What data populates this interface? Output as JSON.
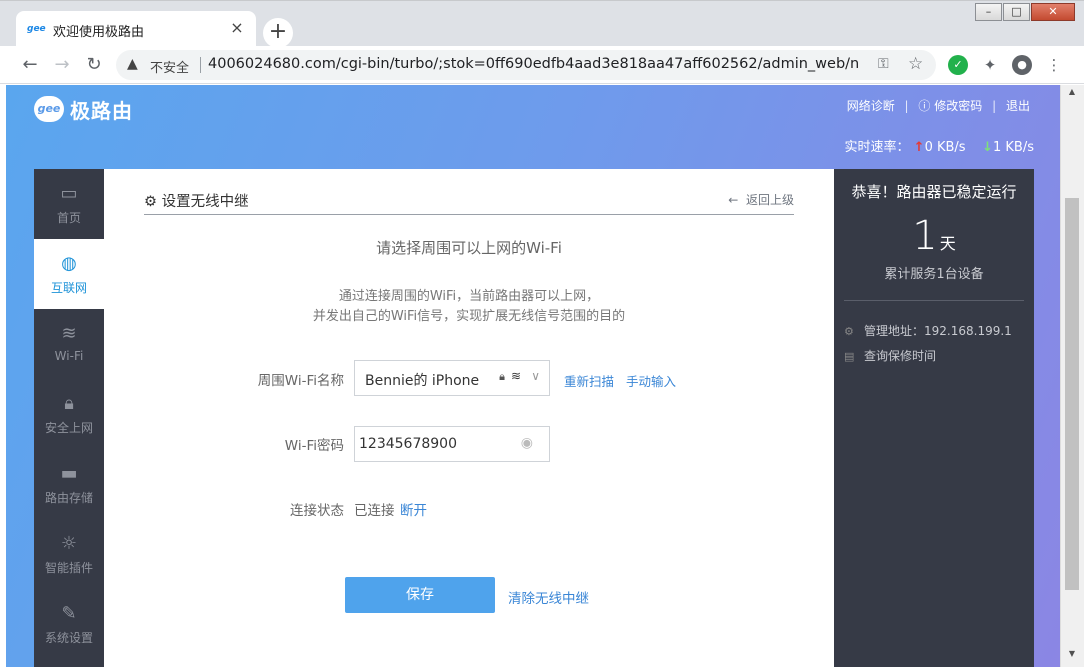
{
  "browser": {
    "tab_title": "欢迎使用极路由",
    "tab_favicon": "gee",
    "url_security": "不安全",
    "url": "4006024680.com/cgi-bin/turbo/;stok=0ff690edfb4aad3e818aa47aff602562/admin_web/networ..."
  },
  "header": {
    "logo_mark": "gee",
    "logo_text": "极路由",
    "links": [
      "网络诊断",
      "修改密码",
      "退出"
    ],
    "speed_label": "实时速率：",
    "upload": "0 KB/s",
    "download": "1 KB/s"
  },
  "sidebar": {
    "items": [
      {
        "label": "首页",
        "icon": "monitor-icon"
      },
      {
        "label": "互联网",
        "icon": "globe-icon"
      },
      {
        "label": "Wi-Fi",
        "icon": "wifi-icon"
      },
      {
        "label": "安全上网",
        "icon": "lock-icon"
      },
      {
        "label": "路由存储",
        "icon": "folder-icon"
      },
      {
        "label": "智能插件",
        "icon": "bulb-icon"
      },
      {
        "label": "系统设置",
        "icon": "wrench-icon"
      }
    ],
    "active_index": 1
  },
  "main": {
    "title": "设置无线中继",
    "back": "返回上级",
    "subtitle": "请选择周围可以上网的Wi-Fi",
    "desc_line1": "通过连接周围的WiFi，当前路由器可以上网，",
    "desc_line2": "并发出自己的WiFi信号，实现扩展无线信号范围的目的",
    "wifi_name_label": "周围Wi-Fi名称",
    "wifi_name_value": "Bennie的 iPhone",
    "rescan": "重新扫描",
    "manual": "手动输入",
    "password_label": "Wi-Fi密码",
    "password_value": "12345678900",
    "status_label": "连接状态",
    "status_value": "已连接",
    "disconnect": "断开",
    "save": "保存",
    "clear": "清除无线中继"
  },
  "panel": {
    "title": "恭喜！路由器已稳定运行",
    "days": "1",
    "days_unit": "天",
    "serve": "累计服务1台设备",
    "admin_addr": "管理地址：192.168.199.1",
    "warranty": "查询保修时间"
  }
}
